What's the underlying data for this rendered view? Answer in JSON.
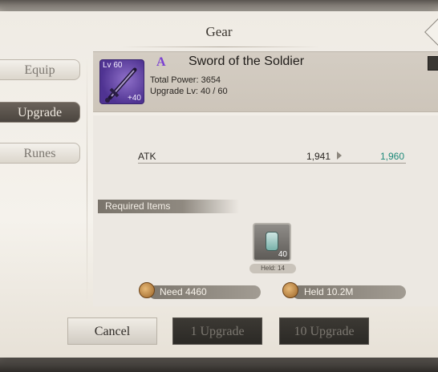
{
  "header": {
    "title": "Gear"
  },
  "tabs": [
    {
      "label": "Equip",
      "active": false
    },
    {
      "label": "Upgrade",
      "active": true
    },
    {
      "label": "Runes",
      "active": false
    }
  ],
  "item": {
    "level": "Lv 60",
    "plus": "+40",
    "grade": "A",
    "name": "Sword of the Soldier",
    "total_power": "Total Power: 3654",
    "upgrade_lv": "Upgrade Lv: 40 / 60"
  },
  "stats": [
    {
      "label": "ATK",
      "current": "1,941",
      "next": "1,960"
    }
  ],
  "required": {
    "label": "Required Items",
    "materials": [
      {
        "icon": "potion-vial-icon",
        "count": "40",
        "held": "Held: 14"
      }
    ]
  },
  "costs": {
    "need": "Need 4460",
    "held": "Held  10.2M"
  },
  "buttons": {
    "cancel": "Cancel",
    "upgrade_1": "1 Upgrade",
    "upgrade_10": "10 Upgrade"
  },
  "colors": {
    "grade_purple": "#7a3fd1",
    "stat_increase": "#1f8a7a",
    "active_tab": "#4b453f"
  }
}
